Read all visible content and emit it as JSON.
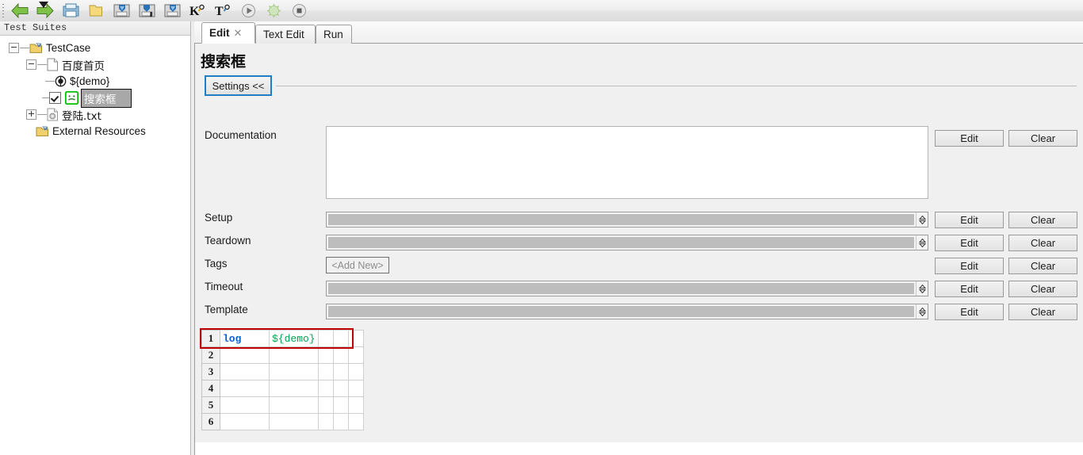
{
  "toolbar": {
    "grip": "toolbar-grip",
    "collapse": "collapse-arrow",
    "buttons": [
      {
        "name": "back-icon",
        "label": "Back"
      },
      {
        "name": "forward-icon",
        "label": "Forward"
      },
      {
        "name": "open-folder-icon",
        "label": "Open"
      },
      {
        "name": "new-folder-icon",
        "label": "New"
      },
      {
        "name": "save-icon",
        "label": "Save"
      },
      {
        "name": "save-as-icon",
        "label": "Save As"
      },
      {
        "name": "save-all-icon",
        "label": "Save All"
      },
      {
        "name": "keyword-icon",
        "label": "K"
      },
      {
        "name": "test-icon",
        "label": "T"
      },
      {
        "name": "run-icon",
        "label": "Run"
      },
      {
        "name": "debug-icon",
        "label": "Debug"
      },
      {
        "name": "stop-icon",
        "label": "Stop"
      }
    ]
  },
  "sidebar": {
    "header": "Test Suites",
    "tree": [
      {
        "label": "TestCase",
        "icon": "suite-folder-icon",
        "expander": "minus",
        "indent": 0,
        "selected": false,
        "checkbox": false
      },
      {
        "label": "百度首页",
        "icon": "file-page-icon",
        "expander": "minus",
        "indent": 1,
        "selected": false,
        "checkbox": false
      },
      {
        "label": "${demo}",
        "icon": "variable-icon",
        "expander": "none",
        "indent": 2,
        "selected": false,
        "checkbox": false
      },
      {
        "label": "搜索框",
        "icon": "testcase-icon",
        "expander": "none",
        "indent": 2,
        "selected": true,
        "checkbox": true
      },
      {
        "label": "登陆.txt",
        "icon": "resource-file-icon",
        "expander": "plus",
        "indent": 1,
        "selected": false,
        "checkbox": false
      },
      {
        "label": "External Resources",
        "icon": "ext-folder-icon",
        "expander": "none",
        "indent": 0,
        "selected": false,
        "checkbox": false
      }
    ]
  },
  "editor": {
    "tabs": [
      {
        "label": "Edit",
        "active": true,
        "closable": true,
        "close_glyph": "✕"
      },
      {
        "label": "Text Edit",
        "active": false,
        "closable": false,
        "close_glyph": ""
      },
      {
        "label": "Run",
        "active": false,
        "closable": false,
        "close_glyph": ""
      }
    ],
    "page_title": "搜索框",
    "settings_button": "Settings <<",
    "fields": [
      {
        "label": "Documentation",
        "type": "textarea",
        "value": "",
        "edit": "Edit",
        "clear": "Clear"
      },
      {
        "label": "Setup",
        "type": "combo",
        "value": "",
        "edit": "Edit",
        "clear": "Clear"
      },
      {
        "label": "Teardown",
        "type": "combo",
        "value": "",
        "edit": "Edit",
        "clear": "Clear"
      },
      {
        "label": "Tags",
        "type": "addnew",
        "value": "<Add New>",
        "edit": "Edit",
        "clear": "Clear"
      },
      {
        "label": "Timeout",
        "type": "combo",
        "value": "",
        "edit": "Edit",
        "clear": "Clear"
      },
      {
        "label": "Template",
        "type": "combo",
        "value": "",
        "edit": "Edit",
        "clear": "Clear"
      }
    ],
    "grid": {
      "rows": [
        {
          "num": "1",
          "cells": [
            "log",
            "${demo}",
            "",
            "",
            ""
          ],
          "highlighted": true
        },
        {
          "num": "2",
          "cells": [
            "",
            "",
            "",
            "",
            ""
          ],
          "highlighted": false
        },
        {
          "num": "3",
          "cells": [
            "",
            "",
            "",
            "",
            ""
          ],
          "highlighted": false
        },
        {
          "num": "4",
          "cells": [
            "",
            "",
            "",
            "",
            ""
          ],
          "highlighted": false
        },
        {
          "num": "5",
          "cells": [
            "",
            "",
            "",
            "",
            ""
          ],
          "highlighted": false
        },
        {
          "num": "6",
          "cells": [
            "",
            "",
            "",
            "",
            ""
          ],
          "highlighted": false
        }
      ],
      "keyword_color": "#0a63c8",
      "variable_color": "#00a651",
      "highlight_color": "#c00000"
    }
  },
  "colors": {
    "accent": "#1f7ec4",
    "selection": "#a8a8a8",
    "panel": "#f0f0f0",
    "combo_fill": "#bdbdbd"
  }
}
